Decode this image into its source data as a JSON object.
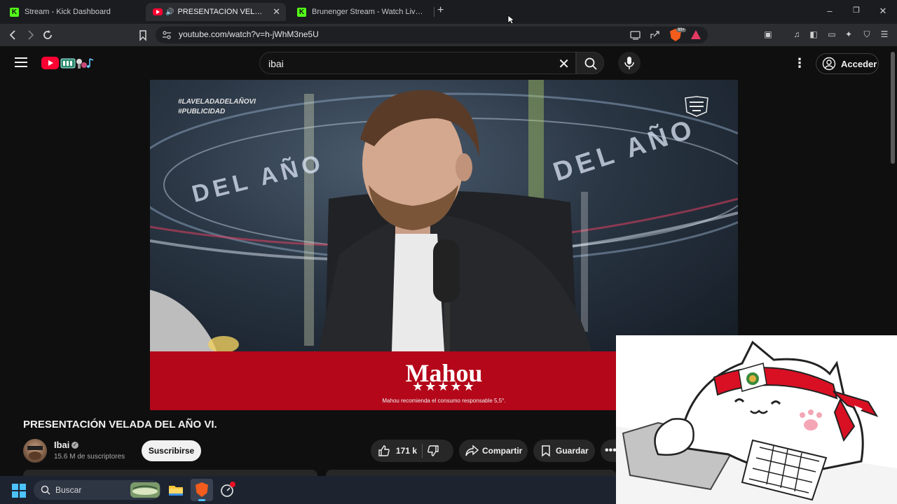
{
  "browser": {
    "tabs": [
      {
        "label": "Stream - Kick Dashboard",
        "favicon": "kick-icon",
        "active": false
      },
      {
        "label": "PRESENTACIÓN VELADA DEL AÑO VI.",
        "favicon": "youtube-icon",
        "active": true
      },
      {
        "label": "Brunenger Stream - Watch Live on Kick",
        "favicon": "kick-icon",
        "active": false
      }
    ],
    "new_tab": "+",
    "url": "youtube.com/watch?v=h-jWhM3ne5U",
    "brave_badge": "99+",
    "window_controls": {
      "minimize": "–",
      "restore": "❐",
      "close": "✕"
    }
  },
  "youtube": {
    "search": {
      "value": "ibai",
      "clear": "✕"
    },
    "signin_label": "Acceder",
    "more": "⋮"
  },
  "video": {
    "overlay": {
      "hashtags": [
        "#LAVELADADELAÑOVI",
        "#PUBLICIDAD"
      ],
      "ring_text": [
        "DEL AÑO",
        "DEL AÑO",
        "DEL AÑO"
      ]
    },
    "ad": {
      "brand": "Mahou",
      "stars": "★★★★★",
      "disclaimer": "Mahou recomienda el consumo responsable 5,5°."
    },
    "title": "PRESENTACIÓN VELADA DEL AÑO VI.",
    "channel": {
      "name": "Ibai",
      "subscribers": "15.6 M de suscriptores"
    },
    "subscribe_label": "Suscribirse",
    "likes": "171 k",
    "share_label": "Compartir",
    "save_label": "Guardar"
  },
  "taskbar": {
    "search_label": "Buscar"
  },
  "colors": {
    "youtube_red": "#ff0033",
    "kick_green": "#53fc18",
    "ad_red": "#b4071a",
    "peru_red": "#d91023"
  }
}
